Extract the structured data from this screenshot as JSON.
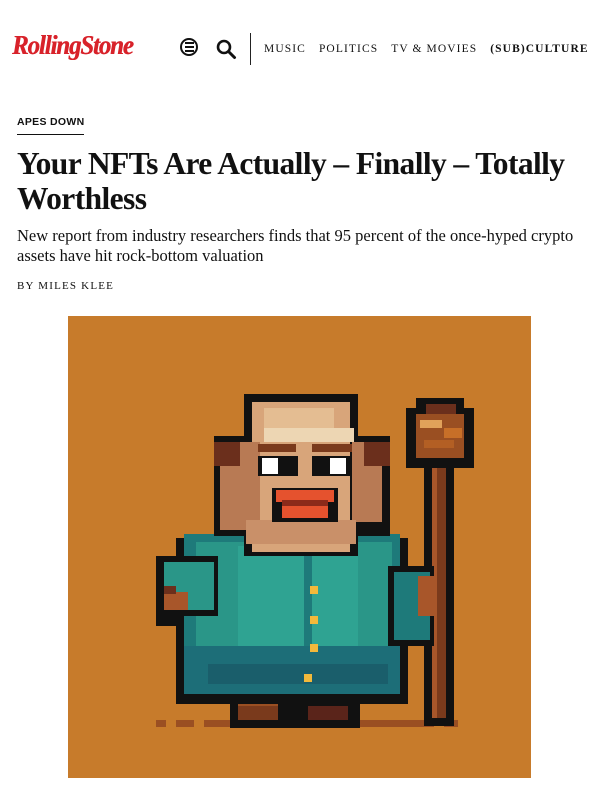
{
  "header": {
    "logo_text": "RollingStone",
    "menu_icon": "menu-icon",
    "search_icon": "search-icon",
    "nav": [
      {
        "label": "MUSIC"
      },
      {
        "label": "POLITICS"
      },
      {
        "label": "TV & MOVIES"
      },
      {
        "label": "(SUB)CULTURE"
      }
    ],
    "brand_color": "#d8222a"
  },
  "article": {
    "kicker": "APES DOWN",
    "headline": "Your NFTs Are Actually – Finally – Totally Worthless",
    "dek": "New report from industry researchers finds that 95 percent of the once-hyped crypto assets have hit rock-bottom valuation",
    "byline_prefix": "BY",
    "author": "MILES KLEE"
  },
  "hero": {
    "background_color": "#c77b2b",
    "subject": "pixel-art-ape-figure-with-staff"
  }
}
